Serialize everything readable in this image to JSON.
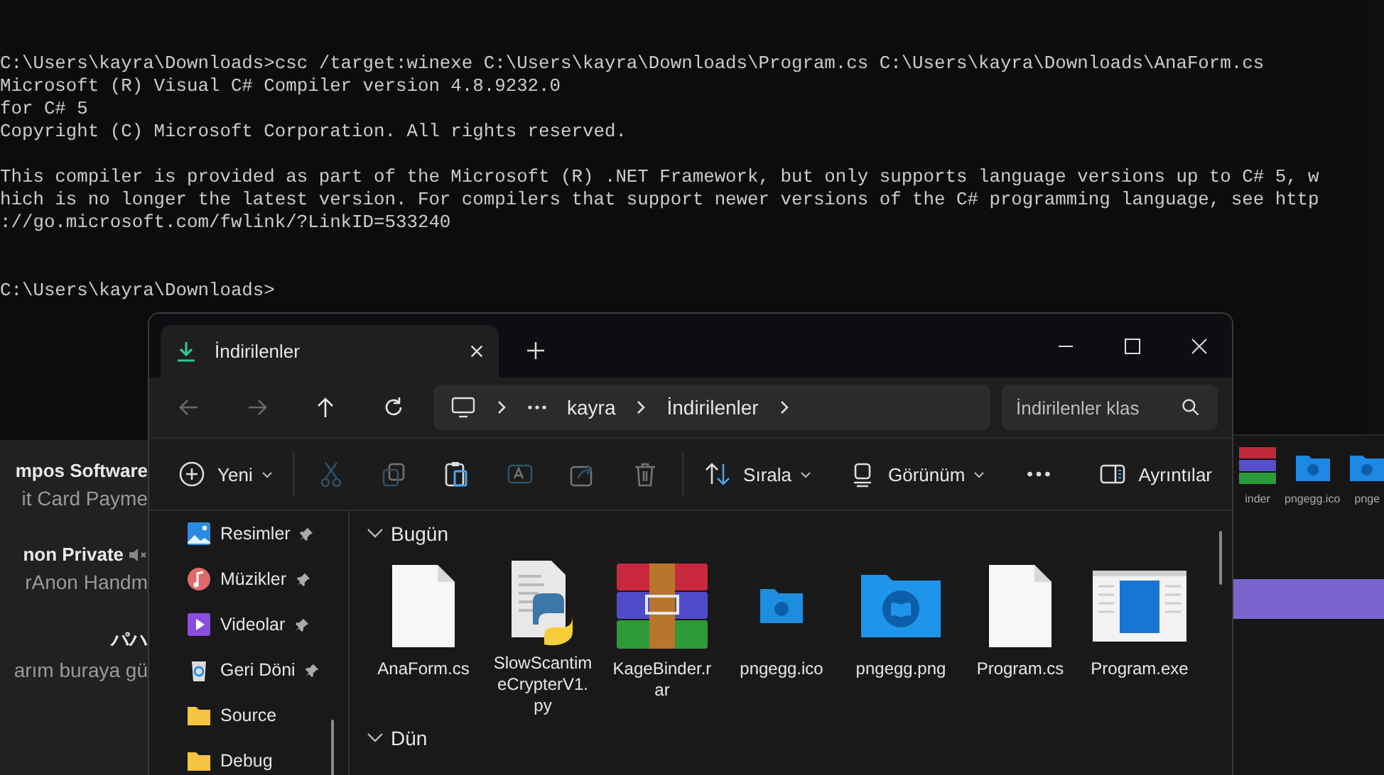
{
  "terminal": {
    "entries": [
      {
        "kind": "command",
        "text": "C:\\Users\\kayra\\Downloads>csc /target:winexe C:\\Users\\kayra\\Downloads\\Program.cs C:\\Users\\kayra\\Downloads\\AnaForm.cs"
      },
      {
        "kind": "output",
        "lines": [
          "Microsoft (R) Visual C# Compiler version 4.8.9232.0",
          "for C# 5",
          "Copyright (C) Microsoft Corporation. All rights reserved."
        ]
      },
      {
        "kind": "output",
        "lines": [
          "This compiler is provided as part of the Microsoft (R) .NET Framework, but only supports language versions up to C# 5, w",
          "hich is no longer the latest version. For compilers that support newer versions of the C# programming language, see http",
          "://go.microsoft.com/fwlink/?LinkID=533240"
        ]
      },
      {
        "kind": "prompt",
        "text": "C:\\Users\\kayra\\Downloads>"
      }
    ]
  },
  "chat_list": {
    "items": [
      {
        "title": "mpos Software",
        "subtitle": "it Card Payme",
        "muted": false
      },
      {
        "title": "non Private",
        "subtitle": "rAnon Handm",
        "muted": true
      },
      {
        "title": "パハ",
        "subtitle": "arım buraya gü",
        "muted": false
      }
    ]
  },
  "desktop": {
    "icons": [
      {
        "label": "inder",
        "kind": "rar"
      },
      {
        "label": "pngegg.ico",
        "kind": "folder"
      },
      {
        "label": "pnge",
        "kind": "folder"
      }
    ]
  },
  "explorer": {
    "tabs": [
      {
        "title": "İndirilenler",
        "selected": true
      }
    ],
    "nav_buttons": [
      {
        "kind": "back",
        "disabled": true
      },
      {
        "kind": "forward",
        "disabled": true
      },
      {
        "kind": "up",
        "disabled": false
      },
      {
        "kind": "refresh",
        "disabled": false
      }
    ],
    "breadcrumb": [
      "kayra",
      "İndirilenler"
    ],
    "search": {
      "placeholder": "İndirilenler klas"
    },
    "commands": [
      {
        "kind": "new",
        "label": "Yeni",
        "disabled": false
      },
      {
        "kind": "cut",
        "disabled": true
      },
      {
        "kind": "copy",
        "disabled": true
      },
      {
        "kind": "paste",
        "disabled": false
      },
      {
        "kind": "rename",
        "disabled": true
      },
      {
        "kind": "share",
        "disabled": true
      },
      {
        "kind": "delete",
        "disabled": true
      },
      {
        "kind": "sort",
        "label": "Sırala",
        "disabled": false
      },
      {
        "kind": "view",
        "label": "Görünüm",
        "disabled": false
      },
      {
        "kind": "more",
        "disabled": false
      },
      {
        "kind": "details",
        "label": "Ayrıntılar",
        "disabled": false
      }
    ],
    "nav_pane": [
      {
        "label": "Resimler",
        "kind": "pictures",
        "pinned": true
      },
      {
        "label": "Müzikler",
        "kind": "music",
        "pinned": true
      },
      {
        "label": "Videolar",
        "kind": "videos",
        "pinned": true
      },
      {
        "label": "Geri Döni",
        "kind": "recycle",
        "pinned": true
      },
      {
        "label": "Source",
        "kind": "folder",
        "pinned": false
      },
      {
        "label": "Debug",
        "kind": "folder",
        "pinned": false
      }
    ],
    "groups": [
      {
        "title": "Bugün",
        "expanded": true,
        "files": [
          {
            "name": "AnaForm.cs",
            "kind": "document"
          },
          {
            "name": "SlowScantimeCrypterV1.py",
            "kind": "python"
          },
          {
            "name": "KageBinder.rar",
            "kind": "archive"
          },
          {
            "name": "pngegg.ico",
            "kind": "small-folder"
          },
          {
            "name": "pngegg.png",
            "kind": "folder"
          },
          {
            "name": "Program.cs",
            "kind": "document"
          },
          {
            "name": "Program.exe",
            "kind": "application"
          }
        ]
      },
      {
        "title": "Dün",
        "expanded": true
      }
    ]
  }
}
